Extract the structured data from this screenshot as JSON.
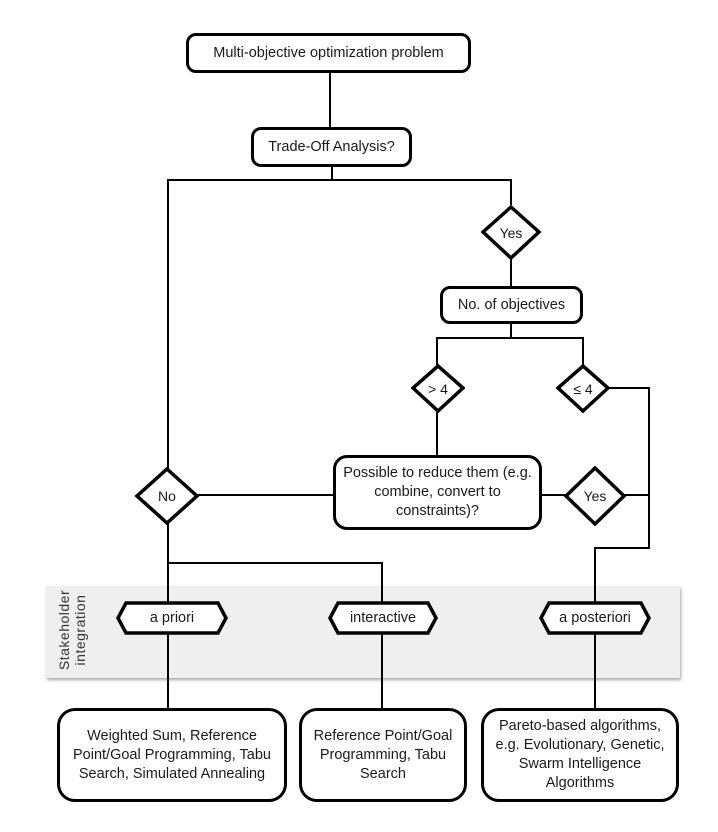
{
  "flowchart": {
    "start": "Multi-objective optimization problem",
    "tradeoff_question": "Trade-Off Analysis?",
    "yes_label": "Yes",
    "no_label": "No",
    "objectives_count": "No. of objectives",
    "more_than_four": "> 4",
    "at_most_four": "≤ 4",
    "reduce_question": "Possible to reduce them (e.g. combine, convert to constraints)?",
    "reduce_yes": "Yes",
    "band_label": "Stakeholder integration",
    "modes": [
      {
        "label": "a priori"
      },
      {
        "label": "interactive"
      },
      {
        "label": "a posteriori"
      }
    ],
    "methods": [
      {
        "text": "Weighted Sum, Reference Point/Goal Programming, Tabu Search, Simulated Annealing"
      },
      {
        "text": "Reference Point/Goal Programming, Tabu Search"
      },
      {
        "text": "Pareto-based algorithms, e.g. Evolutionary, Genetic, Swarm Intelligence Algorithms"
      }
    ]
  }
}
